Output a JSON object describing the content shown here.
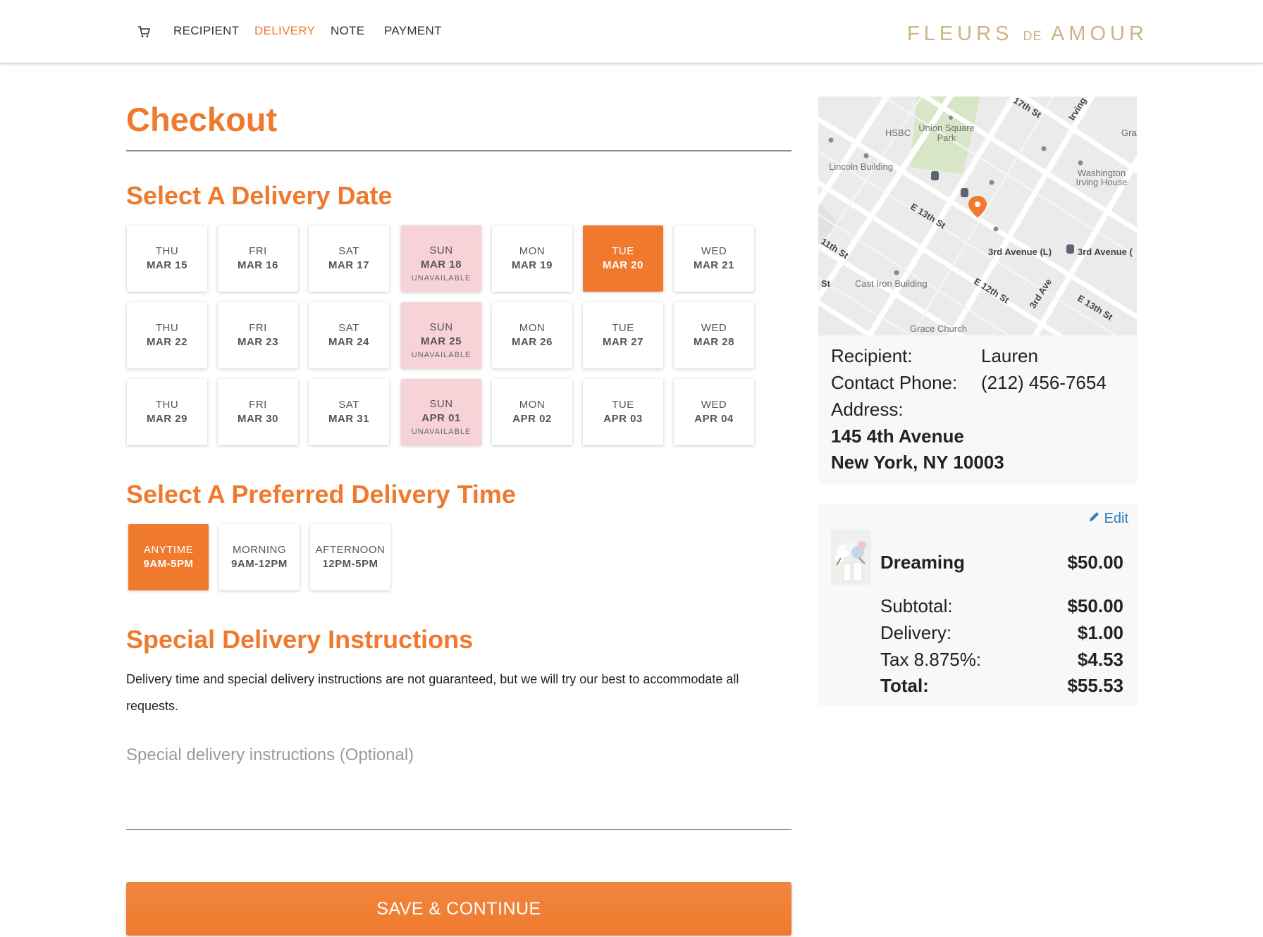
{
  "brand": {
    "name_left": "FLEURS",
    "name_de": "DE",
    "name_right": "AMOUR",
    "accent_color": "#ef7a2e",
    "logo_color": "#cdb487"
  },
  "nav": {
    "cart_icon": "cart-icon",
    "items": [
      {
        "label": "RECIPIENT",
        "active": false
      },
      {
        "label": "DELIVERY",
        "active": true
      },
      {
        "label": "NOTE",
        "active": false
      },
      {
        "label": "PAYMENT",
        "active": false
      }
    ]
  },
  "checkout": {
    "title": "Checkout",
    "date_heading": "Select A Delivery Date",
    "unavailable_label": "UNAVAILABLE",
    "dates": [
      [
        {
          "dow": "THU",
          "date": "MAR 15",
          "status": "available"
        },
        {
          "dow": "FRI",
          "date": "MAR 16",
          "status": "available"
        },
        {
          "dow": "SAT",
          "date": "MAR 17",
          "status": "available"
        },
        {
          "dow": "SUN",
          "date": "MAR 18",
          "status": "unavailable"
        },
        {
          "dow": "MON",
          "date": "MAR 19",
          "status": "available"
        },
        {
          "dow": "TUE",
          "date": "MAR 20",
          "status": "selected"
        },
        {
          "dow": "WED",
          "date": "MAR 21",
          "status": "available"
        }
      ],
      [
        {
          "dow": "THU",
          "date": "MAR 22",
          "status": "available"
        },
        {
          "dow": "FRI",
          "date": "MAR 23",
          "status": "available"
        },
        {
          "dow": "SAT",
          "date": "MAR 24",
          "status": "available"
        },
        {
          "dow": "SUN",
          "date": "MAR 25",
          "status": "unavailable"
        },
        {
          "dow": "MON",
          "date": "MAR 26",
          "status": "available"
        },
        {
          "dow": "TUE",
          "date": "MAR 27",
          "status": "available"
        },
        {
          "dow": "WED",
          "date": "MAR 28",
          "status": "available"
        }
      ],
      [
        {
          "dow": "THU",
          "date": "MAR 29",
          "status": "available"
        },
        {
          "dow": "FRI",
          "date": "MAR 30",
          "status": "available"
        },
        {
          "dow": "SAT",
          "date": "MAR 31",
          "status": "available"
        },
        {
          "dow": "SUN",
          "date": "APR 01",
          "status": "unavailable"
        },
        {
          "dow": "MON",
          "date": "APR 02",
          "status": "available"
        },
        {
          "dow": "TUE",
          "date": "APR 03",
          "status": "available"
        },
        {
          "dow": "WED",
          "date": "APR 04",
          "status": "available"
        }
      ]
    ],
    "time_heading": "Select A Preferred Delivery Time",
    "times": [
      {
        "label": "ANYTIME",
        "range": "9AM-5PM",
        "selected": true
      },
      {
        "label": "MORNING",
        "range": "9AM-12PM",
        "selected": false
      },
      {
        "label": "AFTERNOON",
        "range": "12PM-5PM",
        "selected": false
      }
    ],
    "instructions_heading": "Special Delivery Instructions",
    "instructions_text": "Delivery time and special delivery instructions are not guaranteed, but we will try our best to accommodate all requests.",
    "instructions_placeholder": "Special delivery instructions (Optional)",
    "instructions_value": "",
    "save_label": "SAVE & CONTINUE"
  },
  "map": {
    "labels": [
      "HSBC",
      "Union Square Park",
      "Lincoln Building",
      "Washington Irving House",
      "E 13th St",
      "3rd Avenue (L)",
      "3rd Avenue (",
      "Cast Iron Building",
      "E 12th St",
      "3rd Ave",
      "E 13th St",
      "Grace Church",
      "17th St",
      "Irving",
      "Gra",
      "11th St",
      "St"
    ]
  },
  "recipient": {
    "recipient_label": "Recipient:",
    "recipient_value": "Lauren",
    "phone_label": "Contact Phone:",
    "phone_value": "(212) 456-7654",
    "address_label": "Address:",
    "address_line1": "145 4th Avenue",
    "address_line2": "New York, NY 10003"
  },
  "order": {
    "edit_label": "Edit",
    "item_name": "Dreaming",
    "item_price": "$50.00",
    "subtotal_label": "Subtotal:",
    "subtotal_value": "$50.00",
    "delivery_label": "Delivery:",
    "delivery_value": "$1.00",
    "tax_label": "Tax 8.875%:",
    "tax_value": "$4.53",
    "total_label": "Total:",
    "total_value": "$55.53"
  }
}
